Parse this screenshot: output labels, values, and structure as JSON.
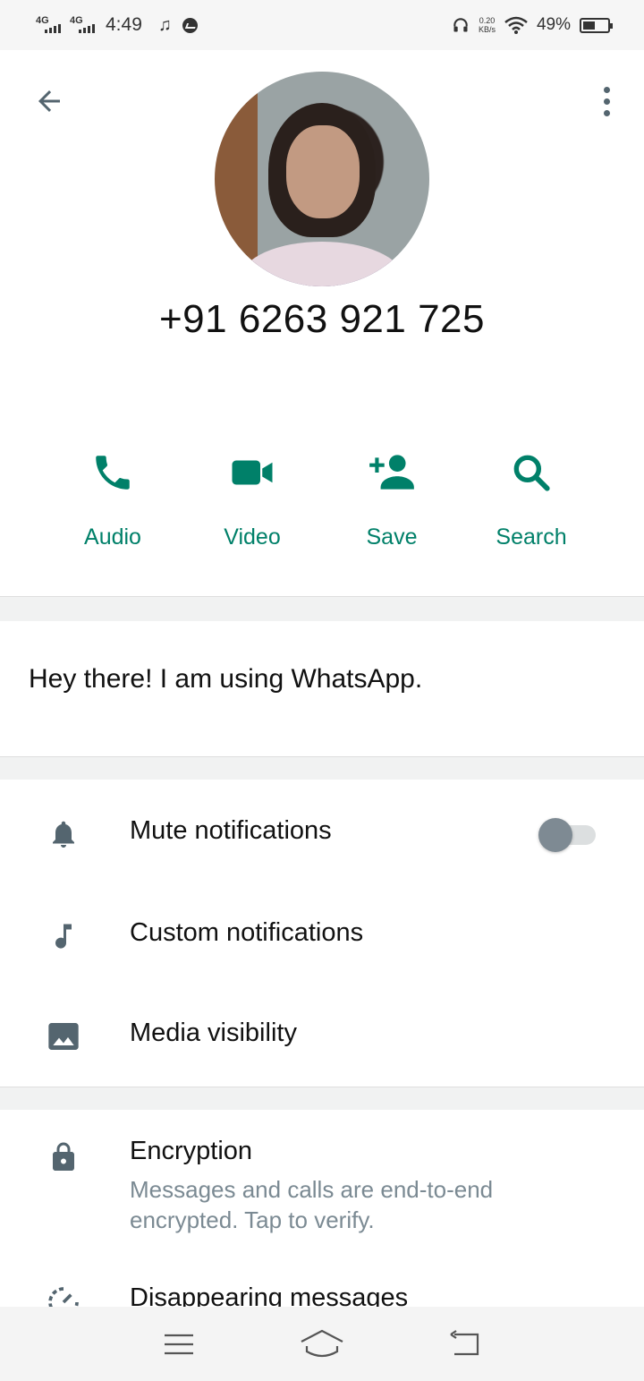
{
  "status_bar": {
    "signal_1": "4G",
    "signal_2": "4G",
    "time": "4:49",
    "net_speed_value": "0.20",
    "net_speed_unit": "KB/s",
    "battery_percent": "49%"
  },
  "profile": {
    "contact_name": "+91 6263 921 725"
  },
  "actions": [
    {
      "label": "Audio",
      "icon": "phone-icon"
    },
    {
      "label": "Video",
      "icon": "video-icon"
    },
    {
      "label": "Save",
      "icon": "add-person-icon"
    },
    {
      "label": "Search",
      "icon": "search-icon"
    }
  ],
  "about": {
    "text": "Hey there! I am using WhatsApp."
  },
  "settings": {
    "mute_label": "Mute notifications",
    "mute_on": false,
    "custom_label": "Custom notifications",
    "media_label": "Media visibility"
  },
  "security": {
    "encryption_title": "Encryption",
    "encryption_desc_1": "Messages and calls are end-to-end",
    "encryption_desc_2": "encrypted. Tap to verify.",
    "disappearing_label": "Disappearing messages"
  },
  "colors": {
    "accent": "#008069",
    "icon_gray": "#54656f",
    "divider": "#f1f2f2"
  }
}
